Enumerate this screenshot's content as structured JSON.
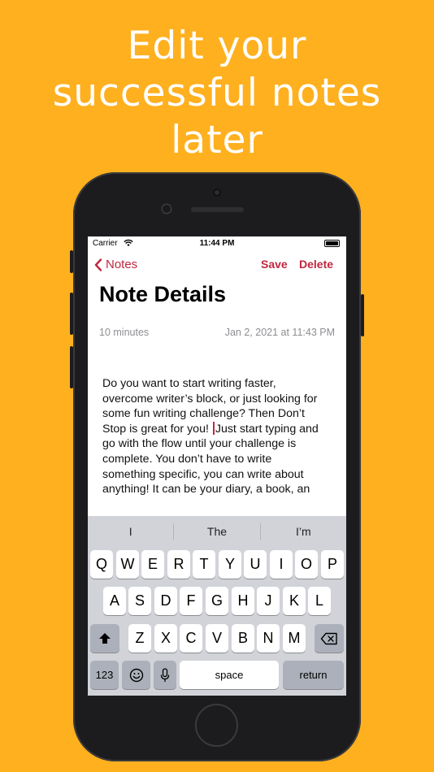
{
  "headline": [
    "Edit your",
    "successful notes",
    "later"
  ],
  "status": {
    "carrier": "Carrier",
    "time": "11:44 PM"
  },
  "nav": {
    "back_label": "Notes",
    "save_label": "Save",
    "delete_label": "Delete"
  },
  "page_title": "Note Details",
  "meta": {
    "duration": "10 minutes",
    "date": "Jan 2, 2021 at 11:43 PM"
  },
  "note": {
    "line1": "Do you want to start writing faster,",
    "line2": "overcome writer’s block, or just looking for",
    "line3": "some fun writing challenge? Then Don’t",
    "line4a": "Stop is great for you! ",
    "line4b": "Just start typing and",
    "line5": "go with the flow until your challenge is",
    "line6": "complete. You don’t have to write",
    "line7": "something specific, you can write about",
    "line8": "anything! It can be your diary, a book, an"
  },
  "keyboard": {
    "predictions": [
      "I",
      "The",
      "I’m"
    ],
    "row1": [
      "Q",
      "W",
      "E",
      "R",
      "T",
      "Y",
      "U",
      "I",
      "O",
      "P"
    ],
    "row2": [
      "A",
      "S",
      "D",
      "F",
      "G",
      "H",
      "J",
      "K",
      "L"
    ],
    "row3": [
      "Z",
      "X",
      "C",
      "V",
      "B",
      "N",
      "M"
    ],
    "numbers_label": "123",
    "space_label": "space",
    "return_label": "return"
  },
  "colors": {
    "background": "#FFB01F",
    "accent": "#C0283F"
  }
}
